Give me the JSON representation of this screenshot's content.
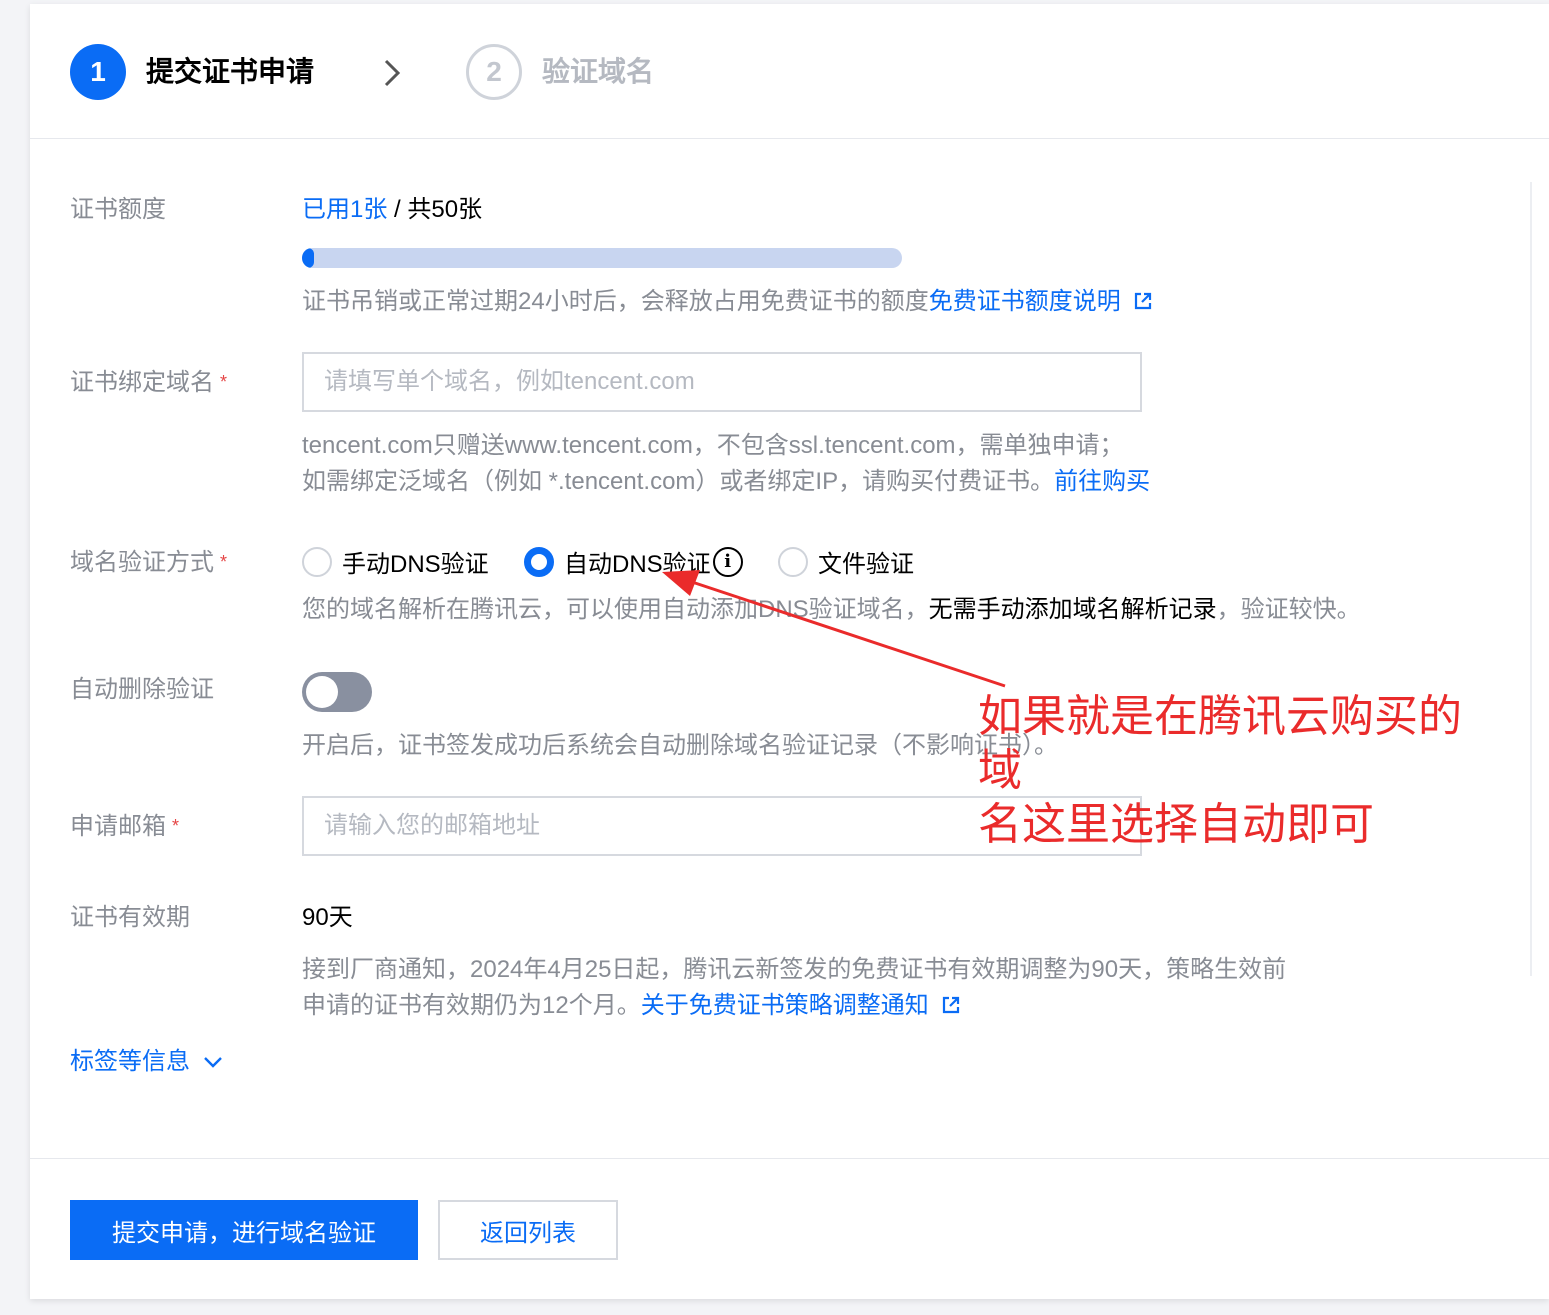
{
  "steps": [
    {
      "number": "1",
      "label": "提交证书申请",
      "state": "active"
    },
    {
      "number": "2",
      "label": "验证域名",
      "state": "inactive"
    }
  ],
  "quota": {
    "label": "证书额度",
    "used": "已用1张",
    "separator": " / ",
    "total": "共50张",
    "used_count": 1,
    "total_count": 50,
    "hint": "证书吊销或正常过期24小时后，会释放占用免费证书的额度",
    "hint_link": "免费证书额度说明"
  },
  "domain": {
    "label": "证书绑定域名",
    "placeholder": "请填写单个域名，例如tencent.com",
    "hint_line1": "tencent.com只赠送www.tencent.com，不包含ssl.tencent.com，需单独申请；",
    "hint_line2": "如需绑定泛域名（例如 *.tencent.com）或者绑定IP，请购买付费证书。",
    "hint_link": "前往购买"
  },
  "verify": {
    "label": "域名验证方式",
    "options": [
      {
        "label": "手动DNS验证",
        "checked": false
      },
      {
        "label": "自动DNS验证",
        "checked": true
      },
      {
        "label": "文件验证",
        "checked": false
      }
    ],
    "hint_part1": "您的域名解析在腾讯云，可以使用自动添加DNS验证域名，",
    "hint_strong": "无需手动添加域名解析记录",
    "hint_part2": "，验证较快。"
  },
  "auto_delete": {
    "label": "自动删除验证",
    "enabled": false,
    "hint": "开启后，证书签发成功后系统会自动删除域名验证记录（不影响证书）。"
  },
  "email": {
    "label": "申请邮箱",
    "placeholder": "请输入您的邮箱地址"
  },
  "validity": {
    "label": "证书有效期",
    "value": "90天",
    "hint_line1": "接到厂商通知，2024年4月25日起，腾讯云新签发的免费证书有效期调整为90天，策略生效前",
    "hint_line2": "申请的证书有效期仍为12个月。",
    "hint_link": "关于免费证书策略调整通知"
  },
  "more": {
    "label": "标签等信息"
  },
  "buttons": {
    "submit": "提交申请，进行域名验证",
    "back": "返回列表"
  },
  "annotation": {
    "text_line1": "如果就是在腾讯云购买的域",
    "text_line2": "名这里选择自动即可",
    "color": "#ea2b2b"
  },
  "colors": {
    "accent": "#0a6cf5",
    "required": "#e54545",
    "muted_text": "#888c94"
  }
}
